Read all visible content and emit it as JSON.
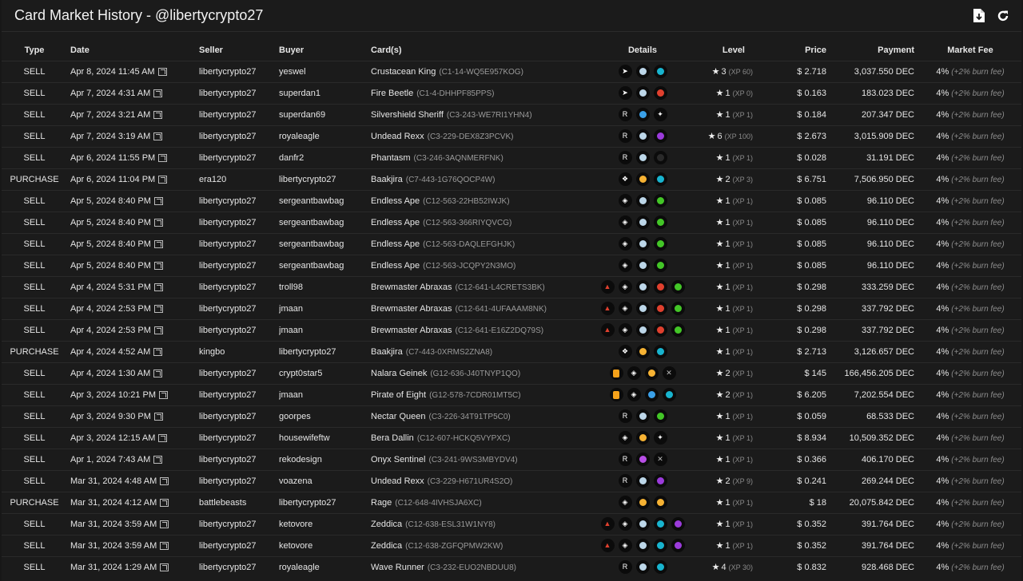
{
  "header": {
    "title": "Card Market History - @libertycrypto27",
    "download_icon": "download-icon",
    "refresh_icon": "refresh-icon"
  },
  "columns": {
    "type": "Type",
    "date": "Date",
    "seller": "Seller",
    "buyer": "Buyer",
    "cards": "Card(s)",
    "details": "Details",
    "level": "Level",
    "price": "Price",
    "payment": "Payment",
    "fee": "Market Fee"
  },
  "colors": {
    "background": "#1b1b1b",
    "water": "#18b4cf",
    "fire": "#e0402e",
    "earth": "#43c627",
    "death": "#9b3bdb",
    "common": "#bdbdbd",
    "rare": "#3aa0e8",
    "epic": "#9b3bdb",
    "legendary": "#f6b233"
  },
  "rows": [
    {
      "type": "SELL",
      "date": "Apr 8, 2024 11:45 AM",
      "seller": "libertycrypto27",
      "buyer": "yeswel",
      "card": "Crustacean King",
      "uid": "(C1-14-WQ5E957KOG)",
      "details": [
        {
          "icon": "edition-beta-icon",
          "glyph": "➤",
          "color": "#ffffff"
        },
        {
          "icon": "rarity-common-icon",
          "color": "#bcd6e8"
        },
        {
          "icon": "element-water-icon",
          "color": "#18b4cf"
        }
      ],
      "level": "3",
      "xp": "(XP 60)",
      "price": "$ 2.718",
      "payment": "3,037.550 DEC",
      "fee": "4%",
      "fee_note": "(+2% burn fee)"
    },
    {
      "type": "SELL",
      "date": "Apr 7, 2024 4:31 AM",
      "seller": "libertycrypto27",
      "buyer": "superdan1",
      "card": "Fire Beetle",
      "uid": "(C1-4-DHHPF85PPS)",
      "details": [
        {
          "icon": "edition-beta-icon",
          "glyph": "➤",
          "color": "#ffffff"
        },
        {
          "icon": "rarity-common-icon",
          "color": "#bcd6e8"
        },
        {
          "icon": "element-fire-icon",
          "color": "#e0402e"
        }
      ],
      "level": "1",
      "xp": "(XP 0)",
      "price": "$ 0.163",
      "payment": "183.023 DEC",
      "fee": "4%",
      "fee_note": "(+2% burn fee)"
    },
    {
      "type": "SELL",
      "date": "Apr 7, 2024 3:21 AM",
      "seller": "libertycrypto27",
      "buyer": "superdan69",
      "card": "Silvershield Sheriff",
      "uid": "(C3-243-WE7RI1YHN4)",
      "details": [
        {
          "icon": "edition-chaos-icon",
          "glyph": "R",
          "color": "#ffffff"
        },
        {
          "icon": "rarity-rare-icon",
          "color": "#3aa0e8"
        },
        {
          "icon": "element-life-icon",
          "glyph": "✦",
          "color": "#f4f4f4"
        }
      ],
      "level": "1",
      "xp": "(XP 1)",
      "price": "$ 0.184",
      "payment": "207.347 DEC",
      "fee": "4%",
      "fee_note": "(+2% burn fee)"
    },
    {
      "type": "SELL",
      "date": "Apr 7, 2024 3:19 AM",
      "seller": "libertycrypto27",
      "buyer": "royaleagle",
      "card": "Undead Rexx",
      "uid": "(C3-229-DEX8Z3PCVK)",
      "details": [
        {
          "icon": "edition-chaos-icon",
          "glyph": "R",
          "color": "#ffffff"
        },
        {
          "icon": "rarity-common-icon",
          "color": "#bcd6e8"
        },
        {
          "icon": "element-death-icon",
          "color": "#9b3bdb"
        }
      ],
      "level": "6",
      "xp": "(XP 100)",
      "price": "$ 2.673",
      "payment": "3,015.909 DEC",
      "fee": "4%",
      "fee_note": "(+2% burn fee)"
    },
    {
      "type": "SELL",
      "date": "Apr 6, 2024 11:55 PM",
      "seller": "libertycrypto27",
      "buyer": "danfr2",
      "card": "Phantasm",
      "uid": "(C3-246-3AQNMERFNK)",
      "details": [
        {
          "icon": "edition-chaos-icon",
          "glyph": "R",
          "color": "#ffffff"
        },
        {
          "icon": "rarity-common-icon",
          "color": "#bcd6e8"
        },
        {
          "icon": "element-neutral-icon",
          "color": "#2a2a2a"
        }
      ],
      "level": "1",
      "xp": "(XP 1)",
      "price": "$ 0.028",
      "payment": "31.191 DEC",
      "fee": "4%",
      "fee_note": "(+2% burn fee)"
    },
    {
      "type": "PURCHASE",
      "date": "Apr 6, 2024 11:04 PM",
      "seller": "era120",
      "buyer": "libertycrypto27",
      "card": "Baakjira",
      "uid": "(C7-443-1G76QOCP4W)",
      "details": [
        {
          "icon": "edition-promo-icon",
          "glyph": "❖",
          "color": "#ffffff"
        },
        {
          "icon": "rarity-legendary-icon",
          "color": "#f6b233"
        },
        {
          "icon": "element-water-icon",
          "color": "#18b4cf"
        }
      ],
      "level": "2",
      "xp": "(XP 3)",
      "price": "$ 6.751",
      "payment": "7,506.950 DEC",
      "fee": "4%",
      "fee_note": "(+2% burn fee)"
    },
    {
      "type": "SELL",
      "date": "Apr 5, 2024 8:40 PM",
      "seller": "libertycrypto27",
      "buyer": "sergeantbawbag",
      "card": "Endless Ape",
      "uid": "(C12-563-22HB52IWJK)",
      "details": [
        {
          "icon": "edition-rebellion-icon",
          "glyph": "◈",
          "color": "#ffffff"
        },
        {
          "icon": "rarity-common-icon",
          "color": "#bcd6e8"
        },
        {
          "icon": "element-earth-icon",
          "color": "#43c627"
        }
      ],
      "level": "1",
      "xp": "(XP 1)",
      "price": "$ 0.085",
      "payment": "96.110 DEC",
      "fee": "4%",
      "fee_note": "(+2% burn fee)"
    },
    {
      "type": "SELL",
      "date": "Apr 5, 2024 8:40 PM",
      "seller": "libertycrypto27",
      "buyer": "sergeantbawbag",
      "card": "Endless Ape",
      "uid": "(C12-563-366RIYQVCG)",
      "details": [
        {
          "icon": "edition-rebellion-icon",
          "glyph": "◈",
          "color": "#ffffff"
        },
        {
          "icon": "rarity-common-icon",
          "color": "#bcd6e8"
        },
        {
          "icon": "element-earth-icon",
          "color": "#43c627"
        }
      ],
      "level": "1",
      "xp": "(XP 1)",
      "price": "$ 0.085",
      "payment": "96.110 DEC",
      "fee": "4%",
      "fee_note": "(+2% burn fee)"
    },
    {
      "type": "SELL",
      "date": "Apr 5, 2024 8:40 PM",
      "seller": "libertycrypto27",
      "buyer": "sergeantbawbag",
      "card": "Endless Ape",
      "uid": "(C12-563-DAQLEFGHJK)",
      "details": [
        {
          "icon": "edition-rebellion-icon",
          "glyph": "◈",
          "color": "#ffffff"
        },
        {
          "icon": "rarity-common-icon",
          "color": "#bcd6e8"
        },
        {
          "icon": "element-earth-icon",
          "color": "#43c627"
        }
      ],
      "level": "1",
      "xp": "(XP 1)",
      "price": "$ 0.085",
      "payment": "96.110 DEC",
      "fee": "4%",
      "fee_note": "(+2% burn fee)"
    },
    {
      "type": "SELL",
      "date": "Apr 5, 2024 8:40 PM",
      "seller": "libertycrypto27",
      "buyer": "sergeantbawbag",
      "card": "Endless Ape",
      "uid": "(C12-563-JCQPY2N3MO)",
      "details": [
        {
          "icon": "edition-rebellion-icon",
          "glyph": "◈",
          "color": "#ffffff"
        },
        {
          "icon": "rarity-common-icon",
          "color": "#bcd6e8"
        },
        {
          "icon": "element-earth-icon",
          "color": "#43c627"
        }
      ],
      "level": "1",
      "xp": "(XP 1)",
      "price": "$ 0.085",
      "payment": "96.110 DEC",
      "fee": "4%",
      "fee_note": "(+2% burn fee)"
    },
    {
      "type": "SELL",
      "date": "Apr 4, 2024 5:31 PM",
      "seller": "libertycrypto27",
      "buyer": "troll98",
      "card": "Brewmaster Abraxas",
      "uid": "(C12-641-L4CRETS3BK)",
      "details": [
        {
          "icon": "edition-rebellion-red-icon",
          "glyph": "▲",
          "color": "#e0402e"
        },
        {
          "icon": "edition-rebellion-icon",
          "glyph": "◈",
          "color": "#ffffff"
        },
        {
          "icon": "rarity-common-icon",
          "color": "#bcd6e8"
        },
        {
          "icon": "element-fire-icon",
          "color": "#e0402e"
        },
        {
          "icon": "element-earth-icon",
          "color": "#43c627"
        }
      ],
      "level": "1",
      "xp": "(XP 1)",
      "price": "$ 0.298",
      "payment": "333.259 DEC",
      "fee": "4%",
      "fee_note": "(+2% burn fee)"
    },
    {
      "type": "SELL",
      "date": "Apr 4, 2024 2:53 PM",
      "seller": "libertycrypto27",
      "buyer": "jmaan",
      "card": "Brewmaster Abraxas",
      "uid": "(C12-641-4UFAAAM8NK)",
      "details": [
        {
          "icon": "edition-rebellion-red-icon",
          "glyph": "▲",
          "color": "#e0402e"
        },
        {
          "icon": "edition-rebellion-icon",
          "glyph": "◈",
          "color": "#ffffff"
        },
        {
          "icon": "rarity-common-icon",
          "color": "#bcd6e8"
        },
        {
          "icon": "element-fire-icon",
          "color": "#e0402e"
        },
        {
          "icon": "element-earth-icon",
          "color": "#43c627"
        }
      ],
      "level": "1",
      "xp": "(XP 1)",
      "price": "$ 0.298",
      "payment": "337.792 DEC",
      "fee": "4%",
      "fee_note": "(+2% burn fee)"
    },
    {
      "type": "SELL",
      "date": "Apr 4, 2024 2:53 PM",
      "seller": "libertycrypto27",
      "buyer": "jmaan",
      "card": "Brewmaster Abraxas",
      "uid": "(C12-641-E16Z2DQ79S)",
      "details": [
        {
          "icon": "edition-rebellion-red-icon",
          "glyph": "▲",
          "color": "#e0402e"
        },
        {
          "icon": "edition-rebellion-icon",
          "glyph": "◈",
          "color": "#ffffff"
        },
        {
          "icon": "rarity-common-icon",
          "color": "#bcd6e8"
        },
        {
          "icon": "element-fire-icon",
          "color": "#e0402e"
        },
        {
          "icon": "element-earth-icon",
          "color": "#43c627"
        }
      ],
      "level": "1",
      "xp": "(XP 1)",
      "price": "$ 0.298",
      "payment": "337.792 DEC",
      "fee": "4%",
      "fee_note": "(+2% burn fee)"
    },
    {
      "type": "PURCHASE",
      "date": "Apr 4, 2024 4:52 AM",
      "seller": "kingbo",
      "buyer": "libertycrypto27",
      "card": "Baakjira",
      "uid": "(C7-443-0XRMS2ZNA8)",
      "details": [
        {
          "icon": "edition-promo-icon",
          "glyph": "❖",
          "color": "#ffffff"
        },
        {
          "icon": "rarity-legendary-icon",
          "color": "#f6b233"
        },
        {
          "icon": "element-water-icon",
          "color": "#18b4cf"
        }
      ],
      "level": "1",
      "xp": "(XP 1)",
      "price": "$ 2.713",
      "payment": "3,126.657 DEC",
      "fee": "4%",
      "fee_note": "(+2% burn fee)"
    },
    {
      "type": "SELL",
      "date": "Apr 4, 2024 1:30 AM",
      "seller": "libertycrypto27",
      "buyer": "crypt0star5",
      "card": "Nalara Geinek",
      "uid": "(G12-636-J40TNYP1QO)",
      "details": [
        {
          "icon": "gladius-icon",
          "glyph": "sq",
          "color": "#f6a21a"
        },
        {
          "icon": "edition-rebellion-icon",
          "glyph": "◈",
          "color": "#ffffff"
        },
        {
          "icon": "rarity-legendary-icon",
          "color": "#f6b233"
        },
        {
          "icon": "element-neutral-icon",
          "glyph": "✕",
          "color": "#bbbbbb"
        }
      ],
      "level": "2",
      "xp": "(XP 1)",
      "price": "$ 145",
      "payment": "166,456.205 DEC",
      "fee": "4%",
      "fee_note": "(+2% burn fee)"
    },
    {
      "type": "SELL",
      "date": "Apr 3, 2024 10:21 PM",
      "seller": "libertycrypto27",
      "buyer": "jmaan",
      "card": "Pirate of Eight",
      "uid": "(G12-578-7CDR01MT5C)",
      "details": [
        {
          "icon": "gladius-icon",
          "glyph": "sq",
          "color": "#f6a21a"
        },
        {
          "icon": "edition-rebellion-icon",
          "glyph": "◈",
          "color": "#ffffff"
        },
        {
          "icon": "rarity-rare-icon",
          "color": "#3aa0e8"
        },
        {
          "icon": "element-water-icon",
          "color": "#18b4cf"
        }
      ],
      "level": "2",
      "xp": "(XP 1)",
      "price": "$ 6.205",
      "payment": "7,202.554 DEC",
      "fee": "4%",
      "fee_note": "(+2% burn fee)"
    },
    {
      "type": "SELL",
      "date": "Apr 3, 2024 9:30 PM",
      "seller": "libertycrypto27",
      "buyer": "goorpes",
      "card": "Nectar Queen",
      "uid": "(C3-226-34T91TP5C0)",
      "details": [
        {
          "icon": "edition-chaos-icon",
          "glyph": "R",
          "color": "#ffffff"
        },
        {
          "icon": "rarity-common-icon",
          "color": "#bcd6e8"
        },
        {
          "icon": "element-earth-icon",
          "color": "#43c627"
        }
      ],
      "level": "1",
      "xp": "(XP 1)",
      "price": "$ 0.059",
      "payment": "68.533 DEC",
      "fee": "4%",
      "fee_note": "(+2% burn fee)"
    },
    {
      "type": "SELL",
      "date": "Apr 3, 2024 12:15 AM",
      "seller": "libertycrypto27",
      "buyer": "housewifeftw",
      "card": "Bera Dallin",
      "uid": "(C12-607-HCKQ5VYPXC)",
      "details": [
        {
          "icon": "edition-rebellion-icon",
          "glyph": "◈",
          "color": "#ffffff"
        },
        {
          "icon": "rarity-legendary-icon",
          "color": "#f6b233"
        },
        {
          "icon": "element-life-icon",
          "glyph": "✦",
          "color": "#f4f4f4"
        }
      ],
      "level": "1",
      "xp": "(XP 1)",
      "price": "$ 8.934",
      "payment": "10,509.352 DEC",
      "fee": "4%",
      "fee_note": "(+2% burn fee)"
    },
    {
      "type": "SELL",
      "date": "Apr 1, 2024 7:43 AM",
      "seller": "libertycrypto27",
      "buyer": "rekodesign",
      "card": "Onyx Sentinel",
      "uid": "(C3-241-9WS3MBYDV4)",
      "details": [
        {
          "icon": "edition-chaos-icon",
          "glyph": "R",
          "color": "#ffffff"
        },
        {
          "icon": "rarity-epic-icon",
          "color": "#b84ee6"
        },
        {
          "icon": "element-neutral-icon",
          "glyph": "✕",
          "color": "#bbbbbb"
        }
      ],
      "level": "1",
      "xp": "(XP 1)",
      "price": "$ 0.366",
      "payment": "406.170 DEC",
      "fee": "4%",
      "fee_note": "(+2% burn fee)"
    },
    {
      "type": "SELL",
      "date": "Mar 31, 2024 4:48 AM",
      "seller": "libertycrypto27",
      "buyer": "voazena",
      "card": "Undead Rexx",
      "uid": "(C3-229-H671UR4S2O)",
      "details": [
        {
          "icon": "edition-chaos-icon",
          "glyph": "R",
          "color": "#ffffff"
        },
        {
          "icon": "rarity-common-icon",
          "color": "#bcd6e8"
        },
        {
          "icon": "element-death-icon",
          "color": "#9b3bdb"
        }
      ],
      "level": "2",
      "xp": "(XP 9)",
      "price": "$ 0.241",
      "payment": "269.244 DEC",
      "fee": "4%",
      "fee_note": "(+2% burn fee)"
    },
    {
      "type": "PURCHASE",
      "date": "Mar 31, 2024 4:12 AM",
      "seller": "battlebeasts",
      "buyer": "libertycrypto27",
      "card": "Rage",
      "uid": "(C12-648-4IVHSJA6XC)",
      "details": [
        {
          "icon": "edition-rebellion-icon",
          "glyph": "◈",
          "color": "#ffffff"
        },
        {
          "icon": "rarity-legendary-icon",
          "color": "#f6b233"
        },
        {
          "icon": "element-dragon-icon",
          "color": "#f6b233"
        }
      ],
      "level": "1",
      "xp": "(XP 1)",
      "price": "$ 18",
      "payment": "20,075.842 DEC",
      "fee": "4%",
      "fee_note": "(+2% burn fee)"
    },
    {
      "type": "SELL",
      "date": "Mar 31, 2024 3:59 AM",
      "seller": "libertycrypto27",
      "buyer": "ketovore",
      "card": "Zeddica",
      "uid": "(C12-638-ESL31W1NY8)",
      "details": [
        {
          "icon": "edition-rebellion-red-icon",
          "glyph": "▲",
          "color": "#e0402e"
        },
        {
          "icon": "edition-rebellion-icon",
          "glyph": "◈",
          "color": "#ffffff"
        },
        {
          "icon": "rarity-common-icon",
          "color": "#bcd6e8"
        },
        {
          "icon": "element-water-icon",
          "color": "#18b4cf"
        },
        {
          "icon": "element-death-icon",
          "color": "#9b3bdb"
        }
      ],
      "level": "1",
      "xp": "(XP 1)",
      "price": "$ 0.352",
      "payment": "391.764 DEC",
      "fee": "4%",
      "fee_note": "(+2% burn fee)"
    },
    {
      "type": "SELL",
      "date": "Mar 31, 2024 3:59 AM",
      "seller": "libertycrypto27",
      "buyer": "ketovore",
      "card": "Zeddica",
      "uid": "(C12-638-ZGFQPMW2KW)",
      "details": [
        {
          "icon": "edition-rebellion-red-icon",
          "glyph": "▲",
          "color": "#e0402e"
        },
        {
          "icon": "edition-rebellion-icon",
          "glyph": "◈",
          "color": "#ffffff"
        },
        {
          "icon": "rarity-common-icon",
          "color": "#bcd6e8"
        },
        {
          "icon": "element-water-icon",
          "color": "#18b4cf"
        },
        {
          "icon": "element-death-icon",
          "color": "#9b3bdb"
        }
      ],
      "level": "1",
      "xp": "(XP 1)",
      "price": "$ 0.352",
      "payment": "391.764 DEC",
      "fee": "4%",
      "fee_note": "(+2% burn fee)"
    },
    {
      "type": "SELL",
      "date": "Mar 31, 2024 1:29 AM",
      "seller": "libertycrypto27",
      "buyer": "royaleagle",
      "card": "Wave Runner",
      "uid": "(C3-232-EUO2NBDUU8)",
      "details": [
        {
          "icon": "edition-chaos-icon",
          "glyph": "R",
          "color": "#ffffff"
        },
        {
          "icon": "rarity-common-icon",
          "color": "#bcd6e8"
        },
        {
          "icon": "element-water-icon",
          "color": "#18b4cf"
        }
      ],
      "level": "4",
      "xp": "(XP 30)",
      "price": "$ 0.832",
      "payment": "928.468 DEC",
      "fee": "4%",
      "fee_note": "(+2% burn fee)"
    }
  ]
}
